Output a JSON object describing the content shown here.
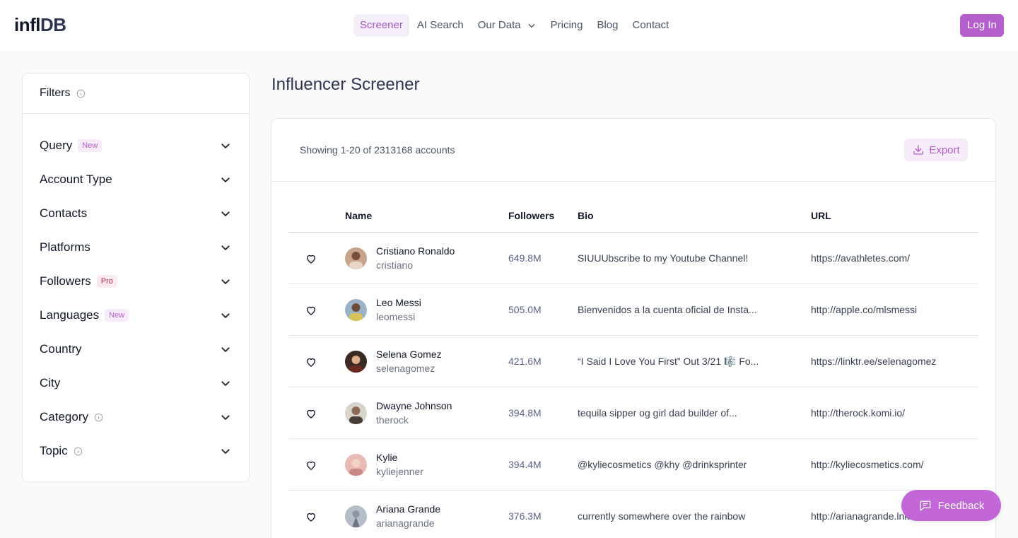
{
  "brand": {
    "logo_part1": "infl",
    "logo_part2": "DB"
  },
  "nav": {
    "links": [
      "Screener",
      "AI Search",
      "Our Data",
      "Pricing",
      "Blog",
      "Contact"
    ],
    "login": "Log In"
  },
  "filters": {
    "title": "Filters",
    "items": [
      {
        "label": "Query",
        "badge": "New"
      },
      {
        "label": "Account Type",
        "badge": ""
      },
      {
        "label": "Contacts",
        "badge": ""
      },
      {
        "label": "Platforms",
        "badge": ""
      },
      {
        "label": "Followers",
        "badge": "Pro"
      },
      {
        "label": "Languages",
        "badge": "New"
      },
      {
        "label": "Country",
        "badge": ""
      },
      {
        "label": "City",
        "badge": ""
      },
      {
        "label": "Category",
        "badge": ""
      },
      {
        "label": "Topic",
        "badge": ""
      }
    ]
  },
  "main": {
    "title": "Influencer Screener",
    "showing": "Showing 1-20 of 2313168 accounts",
    "export": "Export",
    "columns": {
      "name": "Name",
      "followers": "Followers",
      "bio": "Bio",
      "url": "URL"
    },
    "rows": [
      {
        "name": "Cristiano Ronaldo",
        "handle": "cristiano",
        "followers": "649.8M",
        "bio": "SIUUUbscribe to my Youtube Channel!",
        "url": "https://avathletes.com/"
      },
      {
        "name": "Leo Messi",
        "handle": "leomessi",
        "followers": "505.0M",
        "bio": "Bienvenidos a la cuenta oficial de Insta...",
        "url": "http://apple.co/mlsmessi"
      },
      {
        "name": "Selena Gomez",
        "handle": "selenagomez",
        "followers": "421.6M",
        "bio": "“I Said I Love You First” Out 3/21 🎼 Fo...",
        "url": "https://linktr.ee/selenagomez"
      },
      {
        "name": "Dwayne Johnson",
        "handle": "therock",
        "followers": "394.8M",
        "bio": "tequila sipper og girl dad builder of...",
        "url": "http://therock.komi.io/"
      },
      {
        "name": "Kylie",
        "handle": "kyliejenner",
        "followers": "394.4M",
        "bio": "@kyliecosmetics @khy @drinksprinter",
        "url": "http://kyliecosmetics.com/"
      },
      {
        "name": "Ariana Grande",
        "handle": "arianagrande",
        "followers": "376.3M",
        "bio": "currently somewhere over the rainbow",
        "url": "http://arianagrande.lnk.to/"
      }
    ]
  },
  "feedback": "Feedback",
  "colors": {
    "accent": "#b55fcf",
    "accent_light": "#f6ebf9",
    "pro_badge": "#b0324f"
  }
}
